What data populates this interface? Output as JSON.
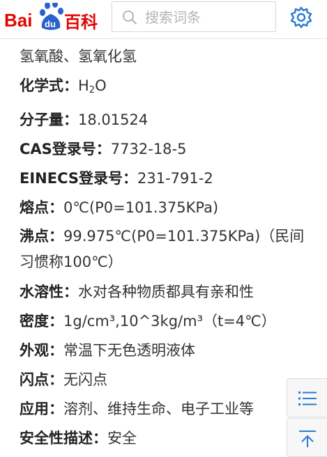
{
  "header": {
    "logo_text": "Bai du 百科",
    "search_placeholder": "搜索词条",
    "brand_red": "#e10602",
    "brand_blue": "#2a61cf"
  },
  "content": {
    "intro": "氢氧酸、氢氧化氢",
    "formula": {
      "label": "化学式",
      "sep": "：",
      "h": "H",
      "sub": "2",
      "o": "O"
    },
    "molar_mass": {
      "label": "分子量",
      "sep": "：",
      "value": "18.01524"
    },
    "cas": {
      "label": "CAS登录号",
      "sep": "：",
      "value": "7732-18-5"
    },
    "einecs": {
      "label": "EINECS登录号",
      "sep": "：",
      "value": "231-791-2"
    },
    "melting": {
      "label": "熔点",
      "sep": "：",
      "value": "0℃(P0=101.375KPa)"
    },
    "boiling": {
      "label": "沸点",
      "sep": "：",
      "value": "99.975℃(P0=101.375KPa)（民间习惯称100℃）"
    },
    "solubility": {
      "label": "水溶性",
      "sep": "：",
      "value": "水对各种物质都具有亲和性"
    },
    "density": {
      "label": "密度",
      "sep": "：",
      "value": "1g/cm³,10^3kg/m³（t=4℃）"
    },
    "appearance": {
      "label": "外观",
      "sep": "：",
      "value": "常温下无色透明液体"
    },
    "flash_point": {
      "label": "闪点",
      "sep": "：",
      "value": "无闪点"
    },
    "application": {
      "label": "应用",
      "sep": "：",
      "value": "溶剂、维持生命、电子工业等"
    },
    "safety": {
      "label": "安全性描述",
      "sep": "：",
      "value": "安全"
    }
  },
  "float_buttons": {
    "menu_icon": "list-icon",
    "top_icon": "back-to-top-icon"
  }
}
